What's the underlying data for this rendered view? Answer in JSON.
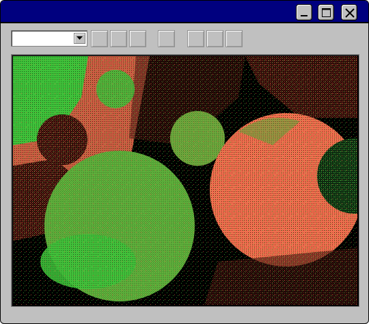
{
  "window": {
    "title": "",
    "titlebar_color": "#00007f",
    "controls": [
      {
        "name": "minimize",
        "icon": "minimize-icon"
      },
      {
        "name": "maximize",
        "icon": "maximize-icon"
      },
      {
        "name": "close",
        "icon": "close-icon"
      }
    ]
  },
  "toolbar": {
    "dropdown": {
      "value": "",
      "icon": "chevron-down-icon"
    },
    "tool_buttons": [
      "",
      "",
      "",
      "",
      "",
      "",
      ""
    ]
  },
  "canvas": {
    "description_colors": {
      "coral": "#f0704f",
      "green": "#3fc23a",
      "olive": "#8a9a3f",
      "dark_red": "#8c2a1f",
      "dark_green": "#1f5a22",
      "background": "#000000"
    }
  }
}
